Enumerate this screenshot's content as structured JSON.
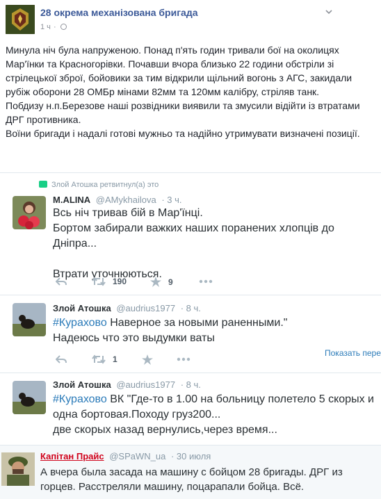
{
  "fb_post": {
    "page_name": "28 окрема механізована бригада",
    "time": "1 ч",
    "body": "Минула ніч була напруженою. Понад п'ять годин тривали бої на околицях Мар'їнки та Красногорівки. Почавши вчора близько 22 години обстріли зі стрілецької зброї, бойовики за тим відкрили щільний вогонь з АГС, закидали рубіж оборони 28 ОМБр мінами 82мм та 120мм калібру, стріляв танк.\nПобдизу н.п.Березове наші розвідники виявили та змусили відійти із втратами ДРГ противника.\nВоїни бригади і надалі готові мужньо та надійно утримувати визначені позиції."
  },
  "retweet_note": "Злой Атошка ретвитнул(а) это",
  "tweets": [
    {
      "name": "M.ALINA",
      "handle": "@AMykhailova",
      "time": "· 3 ч.",
      "hashtag": "",
      "text": "Всь ніч тривав бій в Мар'їнці.\nБортом забирали важких наших поранених хлопців до Дніпра...\n\nВтрати уточнюються.",
      "retweets": "190",
      "likes": "9"
    },
    {
      "name": "Злой Атошка",
      "handle": "@audrius1977",
      "time": "· 8 ч.",
      "hashtag": "#Курахово",
      "text": " Наверное за новыми раненными.\"\nНадеюсь что это выдумки ваты",
      "retweets": "1",
      "likes": ""
    },
    {
      "name": "Злой Атошка",
      "handle": "@audrius1977",
      "time": "· 8 ч.",
      "hashtag": "#Курахово",
      "text": " ВК \"Где-то в 1.00 на больницу полетело 5 скорых и одна бортовая.Походу груз200...\nдве скорых назад вернулись,через время..."
    }
  ],
  "show_more": "Показать пере",
  "quote": {
    "name": "Капітан Прайс",
    "handle": "@SPaWN_ua",
    "time": "· 30 июля",
    "text": "А вчера была засада на машину с бойцом 28 бригады. ДРГ из горцев. Расстреляли машину, поцарапали бойца. Всё."
  },
  "colors": {
    "fb_link": "#3b5998",
    "twitter_link": "#2b7bb9",
    "retweet_green": "#19cf86",
    "quote_name_red": "#d0021b"
  },
  "icons": [
    "brigade-emblem",
    "globe-icon",
    "chevron-down-icon",
    "retweet-icon",
    "reply-icon",
    "star-icon",
    "more-icon"
  ]
}
